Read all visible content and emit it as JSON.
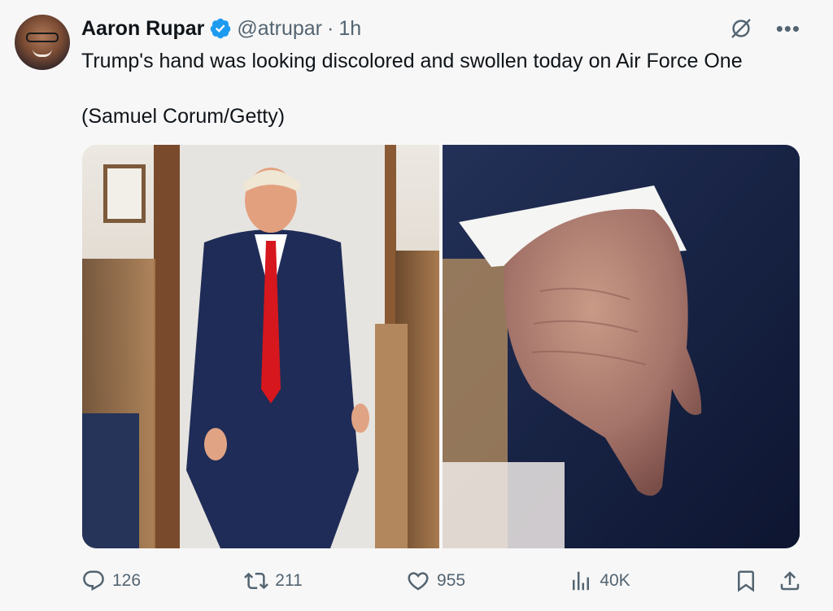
{
  "author": {
    "name": "Aaron Rupar",
    "handle": "@atrupar",
    "separator": "·",
    "time": "1h",
    "verified": true
  },
  "tweet": {
    "text": "Trump's hand was looking discolored and swollen today on Air Force One",
    "credit": "(Samuel Corum/Getty)"
  },
  "media": [
    {
      "icon": "photo-icon",
      "description": ""
    },
    {
      "icon": "photo-icon",
      "description": ""
    }
  ],
  "actions": {
    "replies": "126",
    "reposts": "211",
    "likes": "955",
    "views": "40K"
  },
  "colors": {
    "accent": "#1d9bf0",
    "text": "#0f1419",
    "muted": "#536471",
    "background": "#f7f7f7"
  },
  "icons": {
    "reply": "reply-icon",
    "repost": "repost-icon",
    "like": "heart-icon",
    "views": "views-icon",
    "bookmark": "bookmark-icon",
    "share": "share-icon",
    "grok": "grok-icon",
    "more": "more-icon",
    "verified": "verified-icon"
  }
}
